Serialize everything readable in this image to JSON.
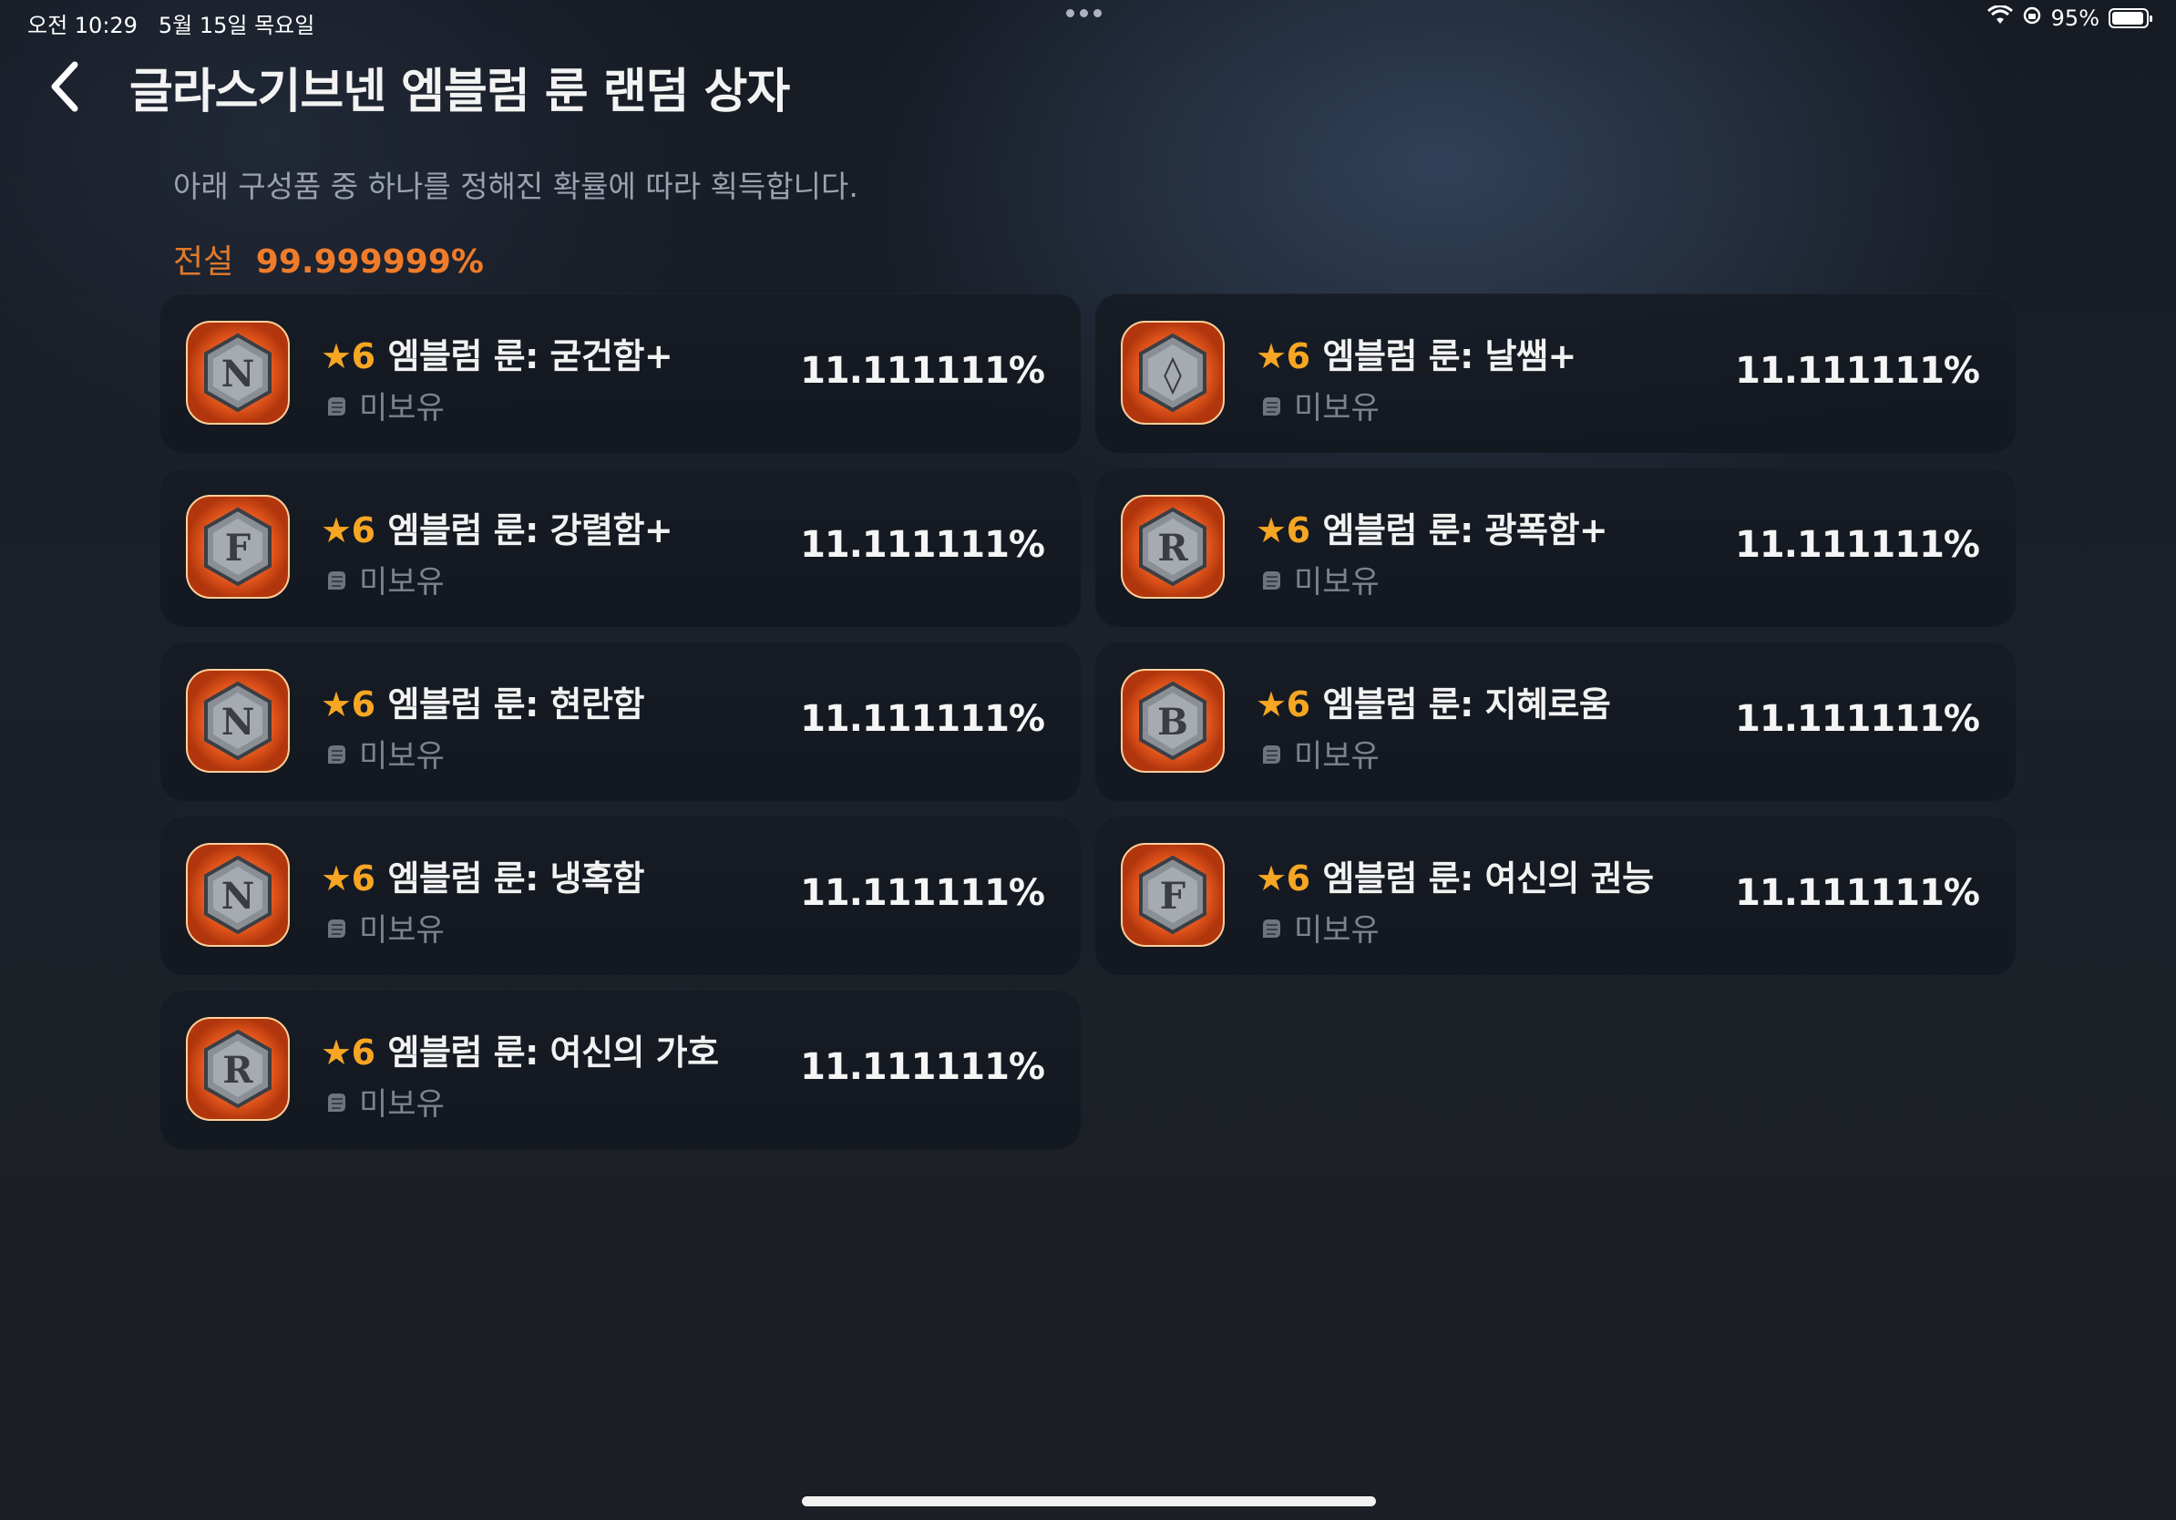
{
  "status_bar": {
    "time": "오전 10:29",
    "date": "5월 15일 목요일",
    "battery": "95%",
    "battery_level": 0.95
  },
  "header": {
    "title": "글라스기브넨 엠블럼 룬 랜덤 상자",
    "back_icon": "chevron-left-icon"
  },
  "subtitle": "아래 구성품 중 하나를 정해진 확률에 따라 획득합니다.",
  "grade": {
    "label": "전설",
    "value": "99.999999%"
  },
  "items": [
    {
      "star": "★",
      "grade": "6",
      "name": "엠블럼 룬: 굳건함+",
      "owned": "미보유",
      "prob": "11.111111%",
      "glyph": "N"
    },
    {
      "star": "★",
      "grade": "6",
      "name": "엠블럼 룬: 날쌤+",
      "owned": "미보유",
      "prob": "11.111111%",
      "glyph": "◊"
    },
    {
      "star": "★",
      "grade": "6",
      "name": "엠블럼 룬: 강렬함+",
      "owned": "미보유",
      "prob": "11.111111%",
      "glyph": "F"
    },
    {
      "star": "★",
      "grade": "6",
      "name": "엠블럼 룬: 광폭함+",
      "owned": "미보유",
      "prob": "11.111111%",
      "glyph": "R"
    },
    {
      "star": "★",
      "grade": "6",
      "name": "엠블럼 룬: 현란함",
      "owned": "미보유",
      "prob": "11.111111%",
      "glyph": "N"
    },
    {
      "star": "★",
      "grade": "6",
      "name": "엠블럼 룬: 지혜로움",
      "owned": "미보유",
      "prob": "11.111111%",
      "glyph": "B"
    },
    {
      "star": "★",
      "grade": "6",
      "name": "엠블럼 룬: 냉혹함",
      "owned": "미보유",
      "prob": "11.111111%",
      "glyph": "N"
    },
    {
      "star": "★",
      "grade": "6",
      "name": "엠블럼 룬: 여신의 권능",
      "owned": "미보유",
      "prob": "11.111111%",
      "glyph": "F"
    },
    {
      "star": "★",
      "grade": "6",
      "name": "엠블럼 룬: 여신의 가호",
      "owned": "미보유",
      "prob": "11.111111%",
      "glyph": "R"
    }
  ],
  "colors": {
    "accent_orange": "#f07c2a",
    "star_gold": "#f6a623",
    "card_bg": "#161b24"
  }
}
